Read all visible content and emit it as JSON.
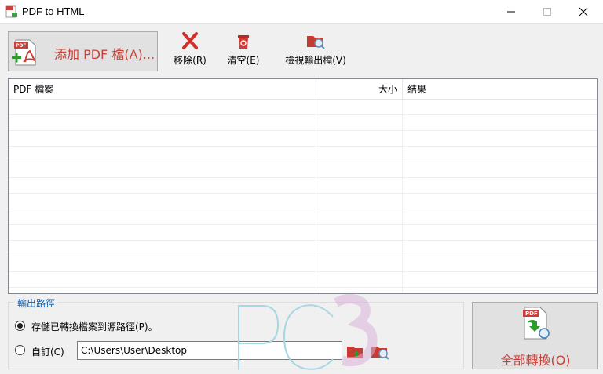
{
  "window": {
    "title": "PDF to HTML"
  },
  "toolbar": {
    "add_label": "添加 PDF 檔(A)...",
    "remove_label": "移除(R)",
    "clear_label": "清空(E)",
    "view_label": "檢視輸出檔(V)"
  },
  "file_list": {
    "columns": [
      "PDF 檔案",
      "大小",
      "結果"
    ],
    "rows": []
  },
  "output": {
    "group_title": "輸出路徑",
    "option_source_label": "存儲已轉換檔案到源路徑(P)。",
    "option_source_selected": true,
    "option_custom_label": "自訂(C)",
    "option_custom_selected": false,
    "custom_path": "C:\\Users\\User\\Desktop"
  },
  "convert": {
    "label": "全部轉換(O)"
  },
  "watermark": {
    "text": "PC3"
  },
  "colors": {
    "accent_red": "#c8423a",
    "group_title_blue": "#0b5fb0"
  }
}
